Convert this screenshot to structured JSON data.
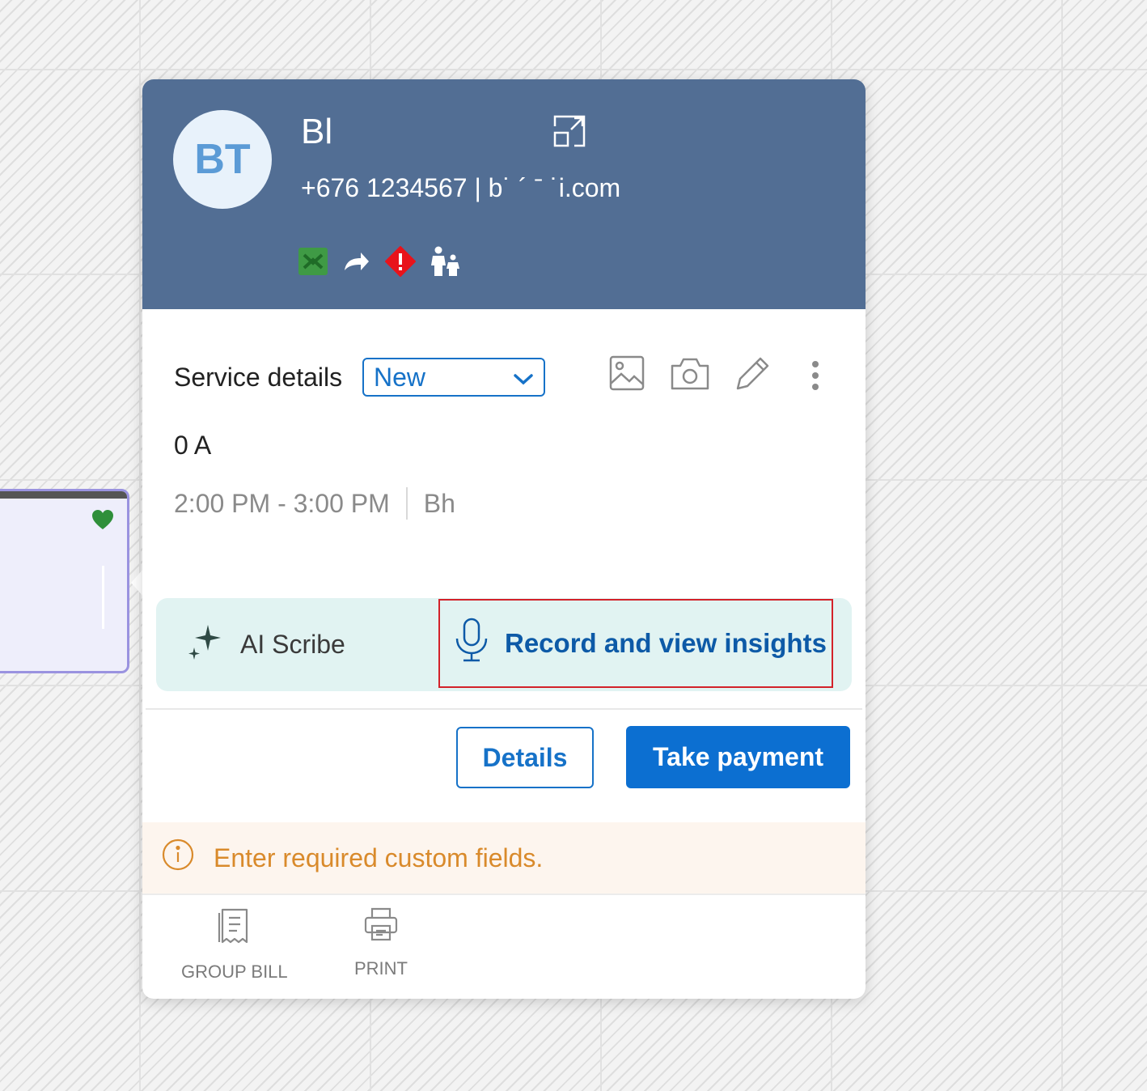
{
  "client": {
    "initials": "BT",
    "name": "Bl",
    "contact": "+676 1234567 | b˙      ´   ˉ     ˙i.com"
  },
  "service": {
    "section_label": "Service details",
    "status_selected": "New",
    "service_name": "0 A",
    "time_range": "2:00 PM - 3:00 PM",
    "staff": "Bh"
  },
  "ai": {
    "label": "AI Scribe",
    "record_label": "Record and view insights"
  },
  "actions": {
    "details_label": "Details",
    "pay_label": "Take payment"
  },
  "warning": {
    "text": "Enter required custom fields."
  },
  "footer": {
    "group_bill_label": "GROUP BILL",
    "print_label": "PRINT"
  },
  "icons": {
    "expand": "expand-icon",
    "membership": "membership-icon",
    "forward": "forward-arrow-icon",
    "alert": "alert-diamond-icon",
    "family": "family-icon",
    "image": "image-icon",
    "camera": "camera-icon",
    "edit": "pencil-icon",
    "more": "more-vertical-icon",
    "sparkle": "sparkle-icon",
    "mic": "microphone-icon",
    "info": "info-icon",
    "receipt": "receipt-icon",
    "printer": "printer-icon",
    "heart": "heart-icon"
  },
  "colors": {
    "header_bg": "#526e94",
    "primary": "#0c6fd1",
    "ai_panel_bg": "#e1f3f2",
    "highlight_border": "#d3222a",
    "warning_text": "#d98a2b",
    "warning_bg": "#fdf5ee"
  }
}
